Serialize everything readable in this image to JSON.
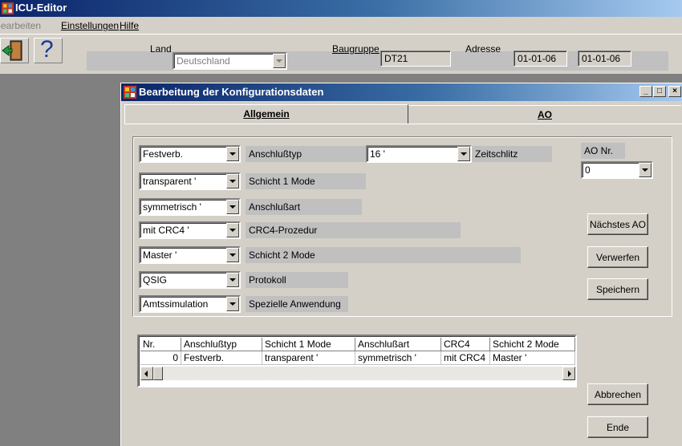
{
  "app": {
    "title": "ICU-Editor"
  },
  "menu": {
    "items": [
      "Bearbeiten",
      "Einstellungen",
      "Hilfe"
    ]
  },
  "toolbar": {
    "help_glyph": "?",
    "land_label": "Land",
    "land_value": "Deutschland",
    "baugruppe_label": "Baugruppe",
    "baugruppe_value": "DT21",
    "adresse_label": "Adresse",
    "adresse_value_1": "01-01-06",
    "adresse_value_2": "01-01-06"
  },
  "dialog": {
    "title": "Bearbeitung der Konfigurationsdaten",
    "caption_buttons": {
      "minimize": "_",
      "maximize": "□",
      "close": "×"
    },
    "tabs": [
      "Allgemein",
      "AO"
    ],
    "rows": [
      {
        "value": "Festverb.",
        "label": "Anschlußtyp"
      },
      {
        "value": "transparent '",
        "label": "Schicht 1 Mode"
      },
      {
        "value": "symmetrisch '",
        "label": "Anschlußart"
      },
      {
        "value": "mit CRC4 '",
        "label": "CRC4-Prozedur"
      },
      {
        "value": "Master '",
        "label": "Schicht 2 Mode"
      },
      {
        "value": "QSIG",
        "label": "Protokoll"
      },
      {
        "value": "Amtssimulation",
        "label": "Spezielle Anwendung"
      }
    ],
    "zeitschlitz": {
      "value": "16 '",
      "label": "Zeitschlitz"
    },
    "ao_nr": {
      "label": "AO Nr.",
      "value": "0"
    },
    "buttons": {
      "naechstes": "Nächstes AO",
      "verwerfen": "Verwerfen",
      "speichern": "Speichern",
      "abbrechen": "Abbrechen",
      "ende": "Ende"
    },
    "table": {
      "columns": [
        "Nr.",
        "Anschlußtyp",
        "Schicht 1 Mode",
        "Anschlußart",
        "CRC4",
        "Schicht 2 Mode"
      ],
      "rows": [
        [
          "0",
          "Festverb.",
          "transparent '",
          "symmetrisch '",
          "mit CRC4",
          "Master '"
        ]
      ]
    }
  }
}
